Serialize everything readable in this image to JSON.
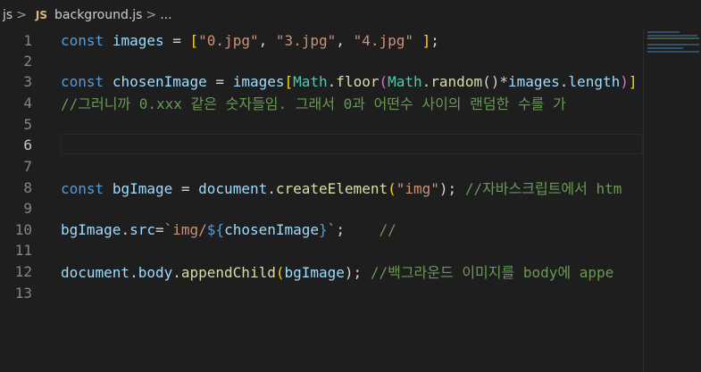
{
  "breadcrumb": {
    "folder": "js",
    "sep1": ">",
    "file_icon": "JS",
    "file": "background.js",
    "sep2": ">",
    "ellipsis": "..."
  },
  "editor": {
    "active_line": "6",
    "lines": [
      {
        "n": "1"
      },
      {
        "n": "2"
      },
      {
        "n": "3"
      },
      {
        "n": "4"
      },
      {
        "n": "5"
      },
      {
        "n": "6"
      },
      {
        "n": "7"
      },
      {
        "n": "8"
      },
      {
        "n": "9"
      },
      {
        "n": "10"
      },
      {
        "n": "11"
      },
      {
        "n": "12"
      },
      {
        "n": "13"
      }
    ],
    "tokens": {
      "l1": [
        "const",
        " ",
        "images",
        " = ",
        "[",
        "\"0.jpg\"",
        ", ",
        "\"3.jpg\"",
        ", ",
        "\"4.jpg\"",
        " ",
        "]",
        ";"
      ],
      "l3": [
        "const",
        " ",
        "chosenImage",
        " = ",
        "images",
        "[",
        "Math",
        ".",
        "floor",
        "(",
        "Math",
        ".",
        "random",
        "()",
        "*",
        "images",
        ".",
        "length",
        ")",
        "]"
      ],
      "l4": [
        "//그러니까 0.xxx 같은 숫자들임. 그래서 0과 어떤수 사이의 랜덤한 수를 가"
      ],
      "l8": [
        "const",
        " ",
        "bgImage",
        " = ",
        "document",
        ".",
        "createElement",
        "(",
        "\"img\"",
        "); ",
        "//자바스크립트에서 htm"
      ],
      "l10": [
        "bgImage",
        ".",
        "src",
        "=",
        "`img/",
        "${",
        "chosenImage",
        "}",
        "`",
        ";    ",
        "//"
      ],
      "l12": [
        "document",
        ".",
        "body",
        ".",
        "appendChild",
        "(",
        "bgImage",
        "); ",
        "//백그라운드 이미지를 body에 appe"
      ]
    }
  }
}
